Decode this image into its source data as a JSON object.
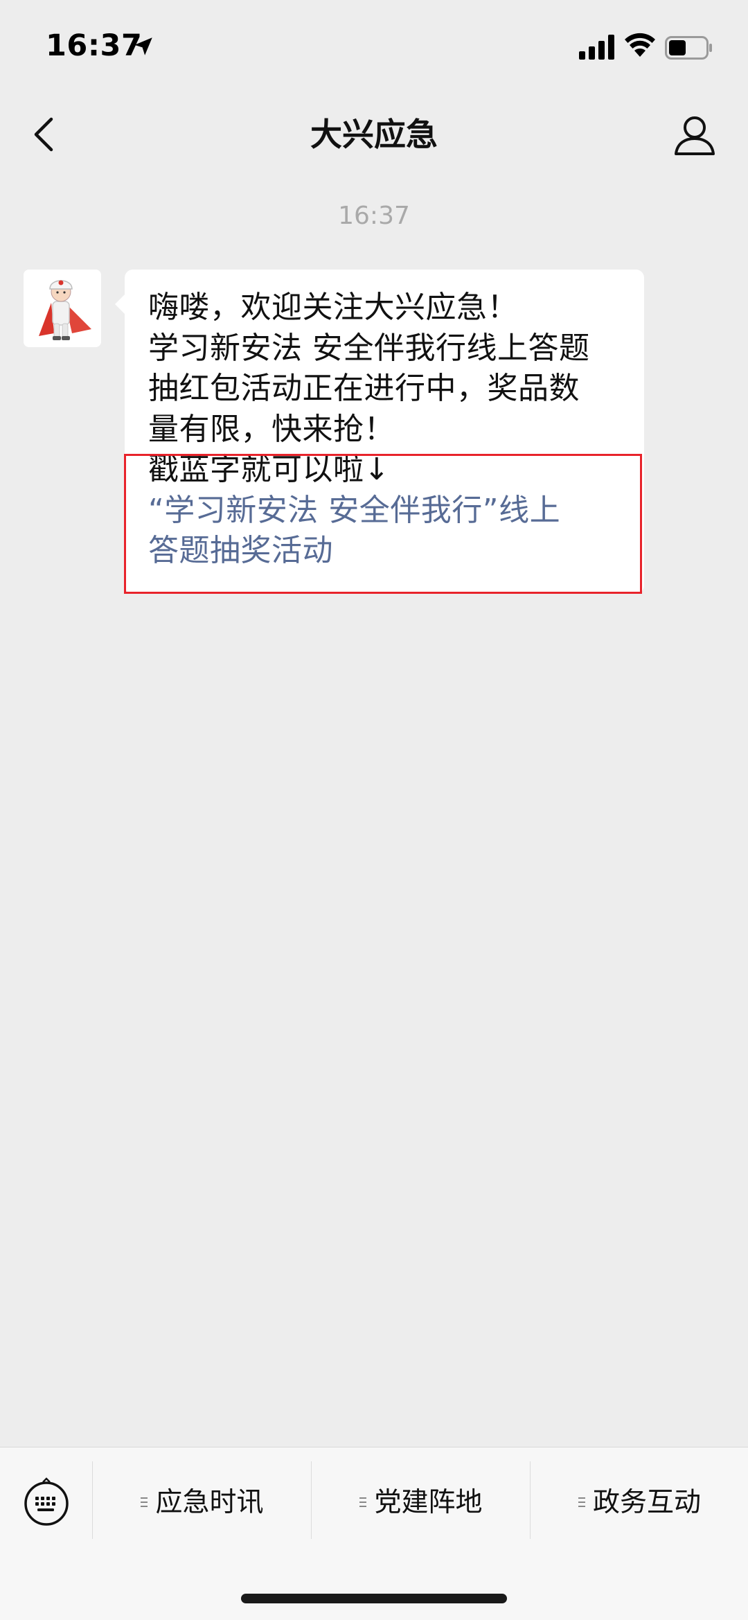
{
  "status_bar": {
    "time": "16:37",
    "icons": [
      "location-arrow-icon",
      "cellular-signal-icon",
      "wifi-icon",
      "battery-icon"
    ]
  },
  "nav": {
    "title": "大兴应急",
    "back_icon": "chevron-left-icon",
    "profile_icon": "person-icon"
  },
  "chat": {
    "timestamp": "16:37",
    "message": {
      "sender_avatar": "mascot-avatar",
      "text_lines": [
        "嗨喽，欢迎关注大兴应急！",
        "学习新安法 安全伴我行线上答题",
        "抽红包活动正在进行中，奖品数",
        "量有限，快来抢！",
        "戳蓝字就可以啦↓"
      ],
      "link_lines": [
        "“学习新安法 安全伴我行”线上",
        "答题抽奖活动"
      ]
    }
  },
  "menu": {
    "keyboard_icon": "keyboard-icon",
    "items": [
      {
        "label": "应急时讯"
      },
      {
        "label": "党建阵地"
      },
      {
        "label": "政务互动"
      }
    ]
  },
  "colors": {
    "background": "#ededed",
    "bubble": "#ffffff",
    "link": "#576b95",
    "highlight": "#e8232b",
    "bottom_bar": "#f7f7f7"
  }
}
